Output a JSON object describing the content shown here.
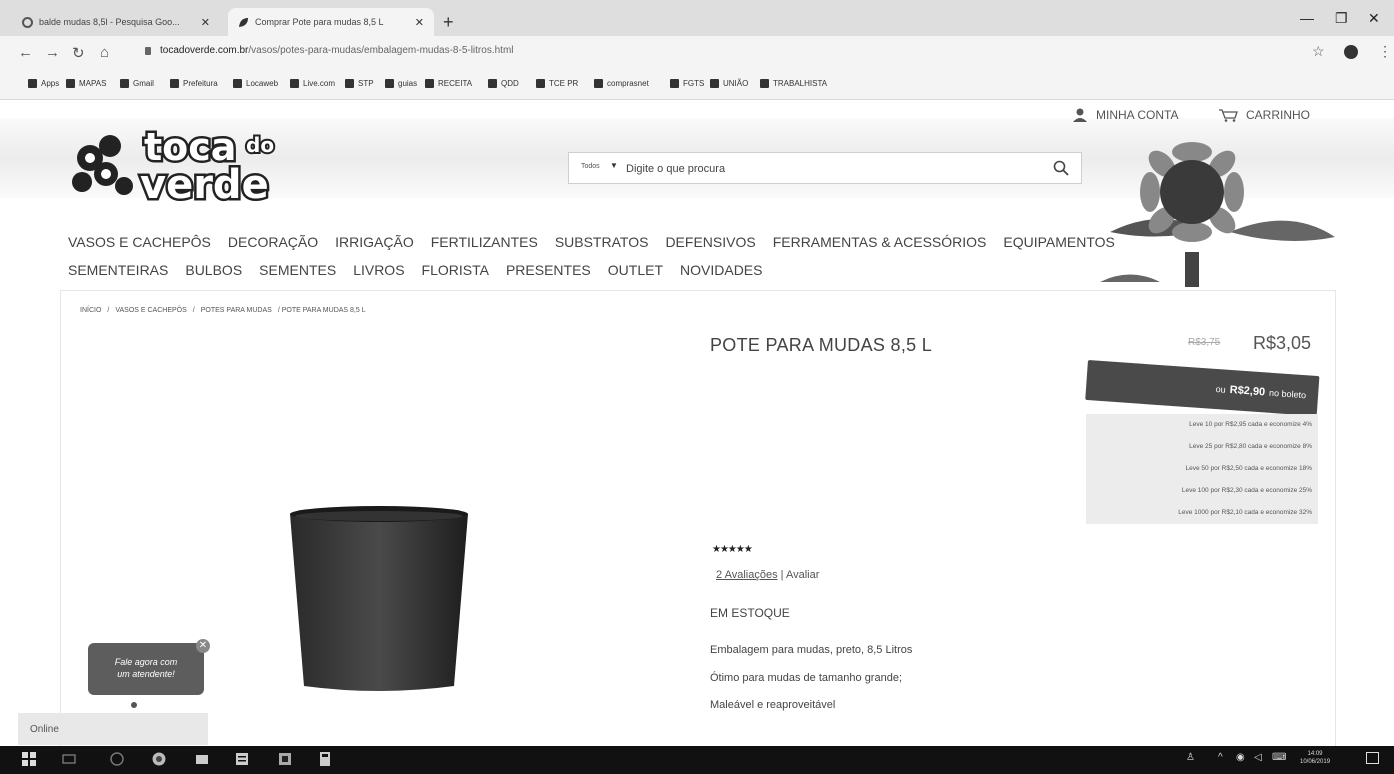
{
  "browser": {
    "tabs": [
      {
        "title": "balde mudas 8,5l - Pesquisa Goo...",
        "active": false
      },
      {
        "title": "Comprar Pote para mudas 8,5 L",
        "active": true
      }
    ],
    "url_domain": "tocadoverde.com.br",
    "url_path": "/vasos/potes-para-mudas/embalagem-mudas-8-5-litros.html",
    "bookmarks": [
      "Apps",
      "MAPAS",
      "Gmail",
      "Prefeitura",
      "Locaweb",
      "Live.com",
      "STP",
      "guias",
      "RECEITA",
      "QDD",
      "TCE PR",
      "comprasnet",
      "FGTS",
      "UNIÃO",
      "TRABALHISTA"
    ]
  },
  "header": {
    "logo_line1": "toca",
    "logo_line1b": "do",
    "logo_line2": "verde",
    "account_label": "MINHA CONTA",
    "cart_label": "CARRINHO",
    "search_category": "Todos",
    "search_placeholder": "Digite o que procura"
  },
  "menu_row1": [
    "VASOS E CACHEPÔS",
    "DECORAÇÃO",
    "IRRIGAÇÃO",
    "FERTILIZANTES",
    "SUBSTRATOS",
    "DEFENSIVOS",
    "FERRAMENTAS & ACESSÓRIOS",
    "EQUIPAMENTOS"
  ],
  "menu_row2": [
    "SEMENTEIRAS",
    "BULBOS",
    "SEMENTES",
    "LIVROS",
    "FLORISTA",
    "PRESENTES",
    "OUTLET",
    "NOVIDADES"
  ],
  "breadcrumb": [
    "INÍCIO",
    "/",
    "VASOS E CACHEPÔS",
    "/",
    "POTES PARA MUDAS",
    "/ POTE PARA MUDAS 8,5 L"
  ],
  "product": {
    "title": "POTE PARA MUDAS 8,5 L",
    "old_price": "R$3,75",
    "price": "R$3,05",
    "boleto_prefix": "ou",
    "boleto_price": "R$2,90",
    "boleto_suffix": "no boleto",
    "tiers": [
      "Leve 10 por R$2,95 cada e economize 4%",
      "Leve 25 por R$2,80 cada e economize 8%",
      "Leve 50 por R$2,50 cada e economize 18%",
      "Leve 100 por R$2,30 cada e economize 25%",
      "Leve 1000 por R$2,10 cada e economize 32%"
    ],
    "stars": "★★★★★",
    "rating": 5,
    "reviews_link": "2 Avaliações",
    "review_action": "| Avaliar",
    "stock": "EM ESTOQUE",
    "description": [
      "Embalagem para mudas, preto, 8,5 Litros",
      "Ótimo para mudas de tamanho grande;",
      "Maleável e reaproveitável"
    ]
  },
  "chat": {
    "bubble_line1": "Fale agora com",
    "bubble_line2": "um atendente!",
    "status": "Online"
  },
  "taskbar": {
    "time": "14:09",
    "date": "10/06/2019"
  }
}
